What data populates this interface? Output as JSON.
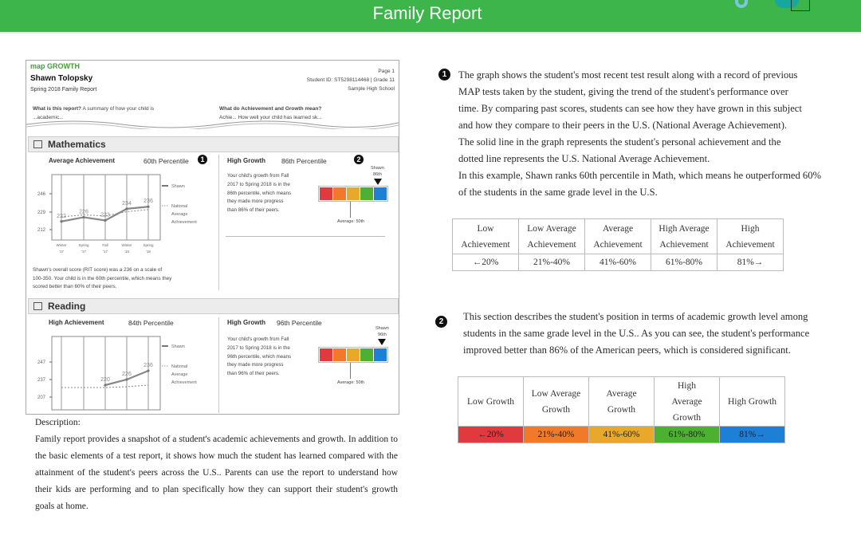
{
  "header": {
    "title": "Family Report"
  },
  "report": {
    "logo": "map GROWTH",
    "student_name": "Shawn Tolopsky",
    "report_term": "Spring 2018  Family Report",
    "page": "Page 1",
    "student_id": "Student ID: ST5298114468  |  Grade 11",
    "school": "Sample High School",
    "q1": "What is this report?",
    "q1_text": "A summary of how your child is",
    "q1_cut": "...academic...",
    "q2": "What do Achievement and Growth mean?",
    "q2_text": "Achie...  How well your child has learned sk...",
    "math": {
      "title": "Mathematics",
      "achievement": "Average Achievement",
      "ach_pct": "60th Percentile",
      "growth": "High Growth",
      "growth_pct": "86th Percentile",
      "growth_text": [
        "Your child's growth from Fall",
        "2017 to Spring 2018 is in the",
        "86th percentile, which means",
        "they made more progress",
        "than 86% of their peers."
      ],
      "marker": [
        "Shawn",
        "86th"
      ],
      "avg_label": "Average: 50th",
      "score_text": [
        "Shawn's overall score (RIT score) was a 236 on a scale of",
        "100-350. Your child is in the 60th percentile, which means they",
        "scored better than 60% of their peers."
      ]
    },
    "reading": {
      "title": "Reading",
      "achievement": "High Achievement",
      "ach_pct": "84th Percentile",
      "growth": "High Growth",
      "growth_pct": "96th Percentile",
      "growth_text": [
        "Your child's growth from Fall",
        "2017 to Spring 2018 is in the",
        "96th percentile, which means",
        "they made more progress",
        "than 96% of their peers."
      ],
      "marker": [
        "Shawn",
        "96th"
      ],
      "avg_label": "Average: 50th"
    },
    "legend": {
      "shawn": "Shawn",
      "national": [
        "National",
        "Average",
        "Achievement"
      ]
    }
  },
  "chart_data": [
    {
      "type": "line",
      "title": "Mathematics",
      "categories": [
        "Winter '17",
        "Spring '17",
        "Fall '17",
        "Winter '18",
        "Spring '18"
      ],
      "yticks": [
        246,
        229,
        212
      ],
      "series": [
        {
          "name": "Shawn",
          "values": [
            222,
            226,
            223,
            234,
            236
          ],
          "labels": [
            "222",
            "226",
            "223",
            "234",
            "236"
          ]
        },
        {
          "name": "National Average Achievement",
          "values": [
            224,
            226,
            225,
            229,
            231
          ]
        }
      ]
    },
    {
      "type": "line",
      "title": "Reading",
      "categories": [
        "",
        "",
        "",
        "",
        ""
      ],
      "yticks": [
        247,
        237,
        207
      ],
      "series": [
        {
          "name": "Shawn",
          "values": [
            null,
            null,
            220,
            226,
            236
          ],
          "labels": [
            "",
            "",
            "220",
            "226",
            "236"
          ]
        },
        {
          "name": "National Average Achievement",
          "values": [
            218,
            218,
            218,
            219,
            220
          ]
        }
      ]
    }
  ],
  "growth_colors": [
    "#e03a3e",
    "#f07a2a",
    "#e8a92a",
    "#4cb030",
    "#1d7fd6"
  ],
  "explain1": {
    "lines": [
      "The graph shows the student's most recent test result along with a record of previous",
      "MAP tests taken by the student, giving the trend of the student's performance over",
      "time. By comparing past scores, students can see how they have grown in this subject",
      "and how they compare to their peers in the U.S. (National Average Achievement).",
      "The solid line in the graph represents the student's personal achievement and the",
      "dotted line represents the U.S. National Average Achievement.",
      "In this example, Shawn ranks 60th percentile in Math, which means he outperformed 60%",
      "of the students in the same grade level in the U.S."
    ],
    "table": {
      "headers": [
        [
          "Low",
          "Achievement"
        ],
        [
          "Low Average",
          "Achievement"
        ],
        [
          "Average",
          "Achievement"
        ],
        [
          "High Average",
          "Achievement"
        ],
        [
          "High",
          "Achievement"
        ]
      ],
      "values": [
        "←20%",
        "21%-40%",
        "41%-60%",
        "61%-80%",
        "81%→"
      ]
    }
  },
  "explain2": {
    "lines": [
      "This section describes the student's position in terms of academic growth level among",
      "students in the same grade level in the U.S.. As you can see, the student's performance",
      "improved better than 86% of the American peers, which is considered significant."
    ],
    "table": {
      "headers": [
        [
          "Low Growth"
        ],
        [
          "Low Average",
          "Growth"
        ],
        [
          "Average",
          "Growth"
        ],
        [
          "High",
          "Average",
          "Growth"
        ],
        [
          "High Growth"
        ]
      ],
      "values": [
        "←20%",
        "21%-40%",
        "41%-60%",
        "61%-80%",
        "81%→"
      ]
    }
  },
  "description": {
    "label": "Description:",
    "text": "Family report provides a snapshot of a student's academic achievements and growth. In addition to the basic elements of a test report, it shows how much the student has learned compared with the attainment of the student's peers across the U.S.. Parents can use the report to understand how their kids are performing and to plan specifically how they can support their student's growth goals at home."
  }
}
